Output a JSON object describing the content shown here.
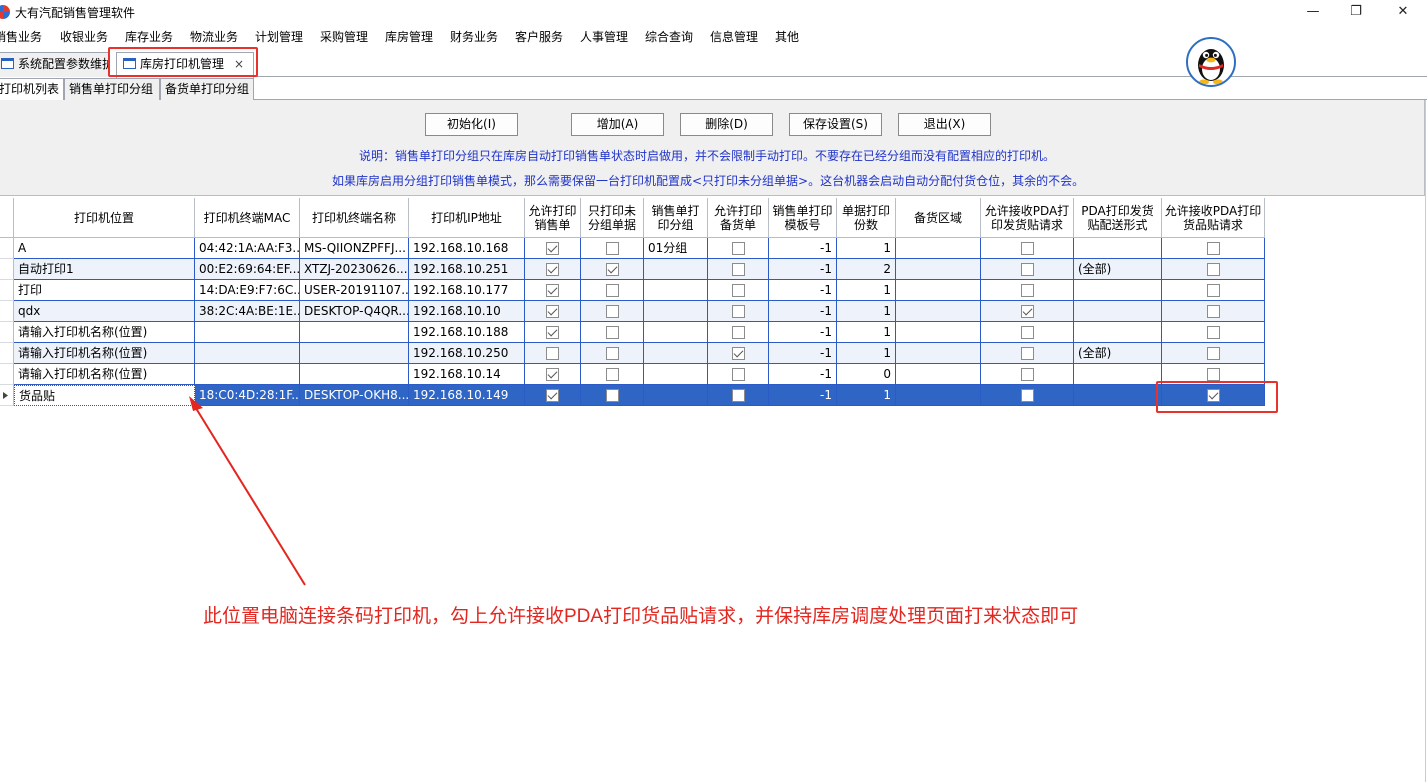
{
  "app": {
    "title": "大有汽配销售管理软件"
  },
  "window_controls": {
    "minimize": "—",
    "restore": "❐",
    "close": "✕"
  },
  "menu": [
    "销售业务",
    "收银业务",
    "库存业务",
    "物流业务",
    "计划管理",
    "采购管理",
    "库房管理",
    "财务业务",
    "客户服务",
    "人事管理",
    "综合查询",
    "信息管理",
    "其他"
  ],
  "doc_tabs": [
    {
      "label": "系统配置参数维护",
      "active": false
    },
    {
      "label": "库房打印机管理",
      "active": true,
      "close": "×"
    }
  ],
  "sub_tabs": [
    "打印机列表",
    "销售单打印分组",
    "备货单打印分组"
  ],
  "buttons": {
    "init": "初始化(I)",
    "add": "增加(A)",
    "delete": "删除(D)",
    "save": "保存设置(S)",
    "exit": "退出(X)"
  },
  "notes": [
    "说明：销售单打印分组只在库房自动打印销售单状态时启做用，并不会限制手动打印。不要存在已经分组而没有配置相应的打印机。",
    "如果库房启用分组打印销售单模式，那么需要保留一台打印机配置成<只打印未分组单据>。这台机器会启动自动分配付货仓位，其余的不会。"
  ],
  "table": {
    "columns": [
      "打印机位置",
      "打印机终端MAC",
      "打印机终端名称",
      "打印机IP地址",
      "允许打印销售单",
      "只打印未分组单据",
      "销售单打印分组",
      "允许打印备货单",
      "销售单打印模板号",
      "单据打印份数",
      "备货区域",
      "允许接收PDA打印发货贴请求",
      "PDA打印发货贴配送形式",
      "允许接收PDA打印货品贴请求"
    ],
    "rows": [
      {
        "location": "A",
        "mac": "04:42:1A:AA:F3...",
        "name": "MS-QIIONZPFFJ...",
        "ip": "192.168.10.168",
        "allow_sales": true,
        "only_ungrouped": false,
        "sales_group": "01分组",
        "allow_stock": false,
        "template": "-1",
        "copies": "1",
        "area": "",
        "pda_ship": false,
        "pda_ship_mode": "",
        "pda_goods": false
      },
      {
        "location": "自动打印1",
        "mac": "00:E2:69:64:EF...",
        "name": "XTZJ-20230626...",
        "ip": "192.168.10.251",
        "allow_sales": true,
        "only_ungrouped": true,
        "sales_group": "",
        "allow_stock": false,
        "template": "-1",
        "copies": "2",
        "area": "",
        "pda_ship": false,
        "pda_ship_mode": "(全部)",
        "pda_goods": false
      },
      {
        "location": "打印",
        "mac": "14:DA:E9:F7:6C...",
        "name": "USER-20191107...",
        "ip": "192.168.10.177",
        "allow_sales": true,
        "only_ungrouped": false,
        "sales_group": "",
        "allow_stock": false,
        "template": "-1",
        "copies": "1",
        "area": "",
        "pda_ship": false,
        "pda_ship_mode": "",
        "pda_goods": false
      },
      {
        "location": "qdx",
        "mac": "38:2C:4A:BE:1E...",
        "name": "DESKTOP-Q4QR...",
        "ip": "192.168.10.10",
        "allow_sales": true,
        "only_ungrouped": false,
        "sales_group": "",
        "allow_stock": false,
        "template": "-1",
        "copies": "1",
        "area": "",
        "pda_ship": true,
        "pda_ship_mode": "",
        "pda_goods": false
      },
      {
        "location": "请输入打印机名称(位置)",
        "mac": "",
        "name": "",
        "ip": "192.168.10.188",
        "allow_sales": true,
        "only_ungrouped": false,
        "sales_group": "",
        "allow_stock": false,
        "template": "-1",
        "copies": "1",
        "area": "",
        "pda_ship": false,
        "pda_ship_mode": "",
        "pda_goods": false
      },
      {
        "location": "请输入打印机名称(位置)",
        "mac": "",
        "name": "",
        "ip": "192.168.10.250",
        "allow_sales": false,
        "only_ungrouped": false,
        "sales_group": "",
        "allow_stock": true,
        "template": "-1",
        "copies": "1",
        "area": "",
        "pda_ship": false,
        "pda_ship_mode": "(全部)",
        "pda_goods": false
      },
      {
        "location": "请输入打印机名称(位置)",
        "mac": "",
        "name": "",
        "ip": "192.168.10.14",
        "allow_sales": true,
        "only_ungrouped": false,
        "sales_group": "",
        "allow_stock": false,
        "template": "-1",
        "copies": "0",
        "area": "",
        "pda_ship": false,
        "pda_ship_mode": "",
        "pda_goods": false
      },
      {
        "location": "货品贴",
        "mac": "18:C0:4D:28:1F...",
        "name": "DESKTOP-OKH8...",
        "ip": "192.168.10.149",
        "allow_sales": true,
        "only_ungrouped": false,
        "sales_group": "",
        "allow_stock": false,
        "template": "-1",
        "copies": "1",
        "area": "",
        "pda_ship": false,
        "pda_ship_mode": "",
        "pda_goods": true,
        "selected": true
      }
    ]
  },
  "annotation": "此位置电脑连接条码打印机，勾上允许接收PDA打印货品贴请求，并保持库房调度处理页面打来状态即可",
  "colors": {
    "highlight": "#e8322b",
    "selection": "#2f66c6",
    "note_text": "#1f33c8"
  },
  "icons": [
    "app-logo-icon",
    "window-tab-icon",
    "qq-penguin-icon",
    "row-pointer-icon"
  ]
}
